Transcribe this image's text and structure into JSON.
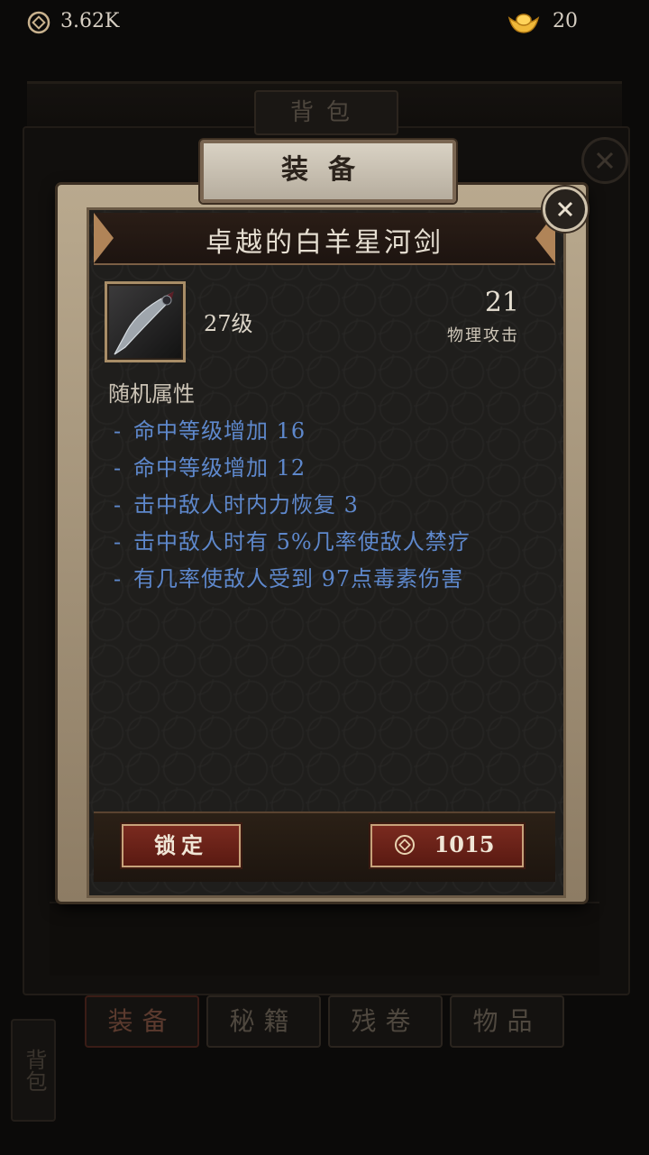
{
  "currency": {
    "coins": "3.62K",
    "ingots": "20"
  },
  "bag": {
    "title": "背包",
    "tabs": [
      "装备",
      "秘籍",
      "残卷",
      "物品"
    ],
    "side_tab": "背包"
  },
  "dialog": {
    "tab_label": "装备",
    "item_name": "卓越的白羊星河剑",
    "level": "27级",
    "stat_value": "21",
    "stat_label": "物理攻击",
    "attributes_header": "随机属性",
    "attributes": [
      "命中等级增加 16",
      "命中等级增加 12",
      "击中敌人时内力恢复 3",
      "击中敌人时有 5%几率使敌人禁疗",
      "有几率使敌人受到 97点毒素伤害"
    ],
    "lock_label": "锁定",
    "sell_price": "1015"
  },
  "colors": {
    "attribute_blue": "#5e88cc",
    "button_red": "#7a2a1f",
    "frame_tan": "#b9a98e"
  }
}
